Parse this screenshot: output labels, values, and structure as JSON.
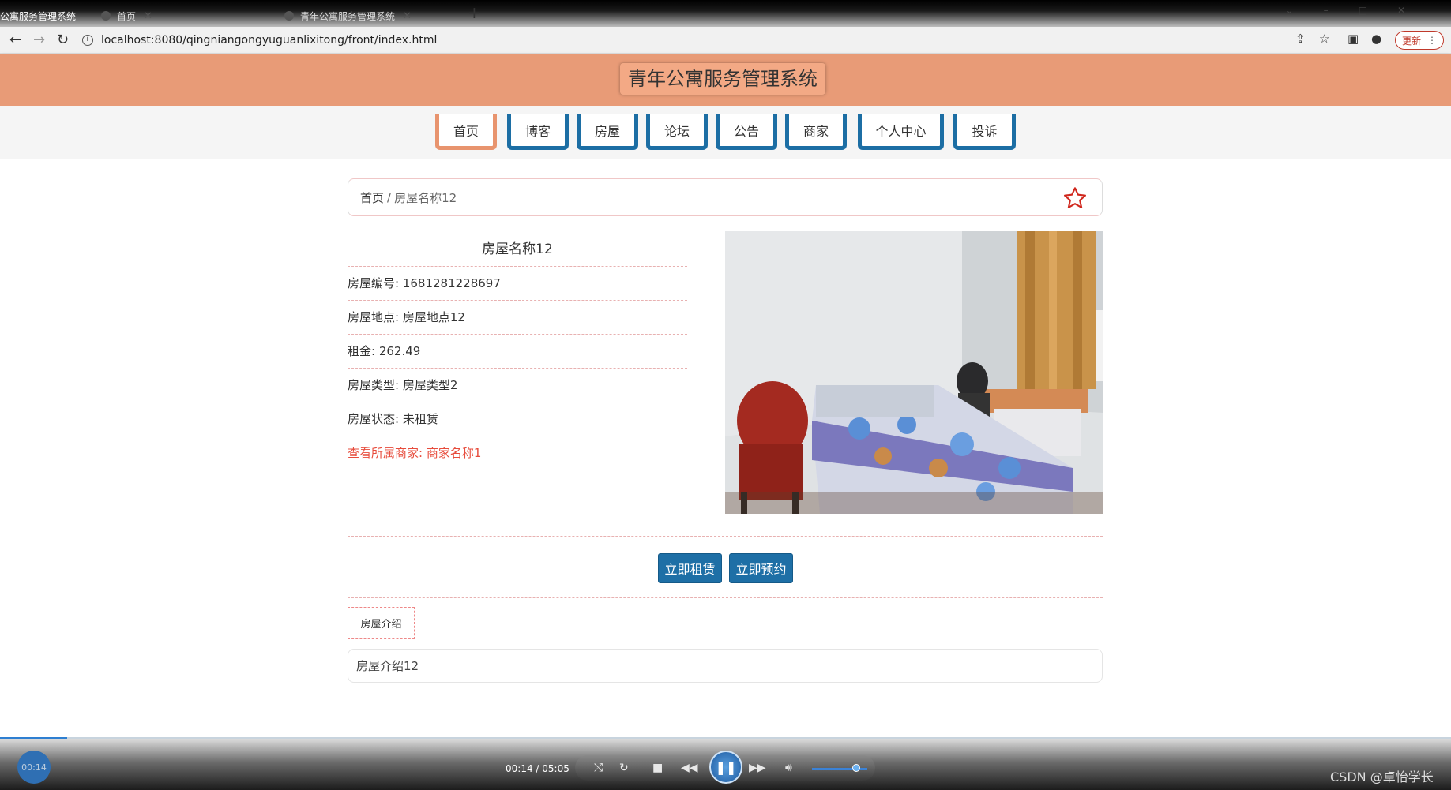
{
  "browser": {
    "tabs": [
      {
        "label": "公寓服务管理系统",
        "active": true
      },
      {
        "label": "首页",
        "active": false
      },
      {
        "label": "青年公寓服务管理系统",
        "active": false
      }
    ],
    "new_tab_symbol": "+",
    "url": "localhost:8080/qingniangongyuguanlixitong/front/index.html",
    "update_label": "更新"
  },
  "site": {
    "title": "青年公寓服务管理系统",
    "nav": [
      {
        "label": "首页",
        "active": true
      },
      {
        "label": "博客"
      },
      {
        "label": "房屋"
      },
      {
        "label": "论坛"
      },
      {
        "label": "公告"
      },
      {
        "label": "商家"
      },
      {
        "label": "个人中心"
      },
      {
        "label": "投诉"
      }
    ]
  },
  "breadcrumb": {
    "home": "首页",
    "separator": "/",
    "current": "房屋名称12"
  },
  "house": {
    "name": "房屋名称12",
    "code": "房屋编号: 1681281228697",
    "location": "房屋地点: 房屋地点12",
    "rent": "租金: 262.49",
    "type": "房屋类型: 房屋类型2",
    "status": "房屋状态: 未租赁",
    "merchant_link": "查看所属商家: 商家名称1"
  },
  "actions": {
    "rent_now": "立即租赁",
    "book_now": "立即预约"
  },
  "intro": {
    "tab_label": "房屋介绍",
    "content": "房屋介绍12"
  },
  "player": {
    "elapsed": "00:14",
    "time_display": "00:14 / 05:05",
    "progress_fraction": 0.046,
    "volume_fraction": 0.8,
    "watermark": "CSDN @卓怡学长"
  },
  "icons": {
    "favorite": "star-outline-icon",
    "back": "arrow-left-icon",
    "forward": "arrow-right-icon",
    "reload": "reload-icon"
  },
  "colors": {
    "header_bg": "#e89b77",
    "nav_border": "#1c6ea4",
    "nav_active_border": "#e8946e",
    "button_bg": "#1e6fa6",
    "link_red": "#e74c3c"
  }
}
